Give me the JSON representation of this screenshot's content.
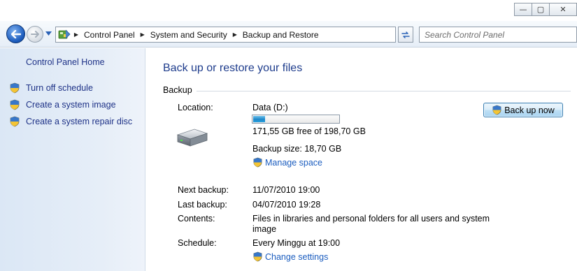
{
  "window": {
    "minimize_glyph": "—",
    "maximize_glyph": "▢",
    "close_glyph": "✕"
  },
  "nav": {
    "breadcrumbs": [
      "Control Panel",
      "System and Security",
      "Backup and Restore"
    ],
    "search_placeholder": "Search Control Panel"
  },
  "sidebar": {
    "home_label": "Control Panel Home",
    "tasks": [
      {
        "label": "Turn off schedule",
        "icon": "uac-shield-icon"
      },
      {
        "label": "Create a system image",
        "icon": "uac-shield-icon"
      },
      {
        "label": "Create a system repair disc",
        "icon": "uac-shield-icon"
      }
    ]
  },
  "main": {
    "title": "Back up or restore your files",
    "section_label": "Backup",
    "location_label": "Location:",
    "location_value": "Data (D:)",
    "space_free": "171,55 GB free of 198,70 GB",
    "used_fraction": 0.137,
    "backup_size": "Backup size: 18,70 GB",
    "manage_space_link": "Manage space",
    "backup_now_button": "Back up now",
    "next_backup_label": "Next backup:",
    "next_backup_value": "11/07/2010 19:00",
    "last_backup_label": "Last backup:",
    "last_backup_value": "04/07/2010 19:28",
    "contents_label": "Contents:",
    "contents_value_line1": "Files in libraries and personal folders for all users and system",
    "contents_value_line2": "image",
    "schedule_label": "Schedule:",
    "schedule_value": "Every Minggu at 19:00",
    "change_settings_link": "Change settings"
  },
  "colors": {
    "link": "#1b5dbf",
    "title": "#1e3c8c",
    "sidebar_bg": "#dbe7f5",
    "progress_fill": "#1e86c9"
  }
}
